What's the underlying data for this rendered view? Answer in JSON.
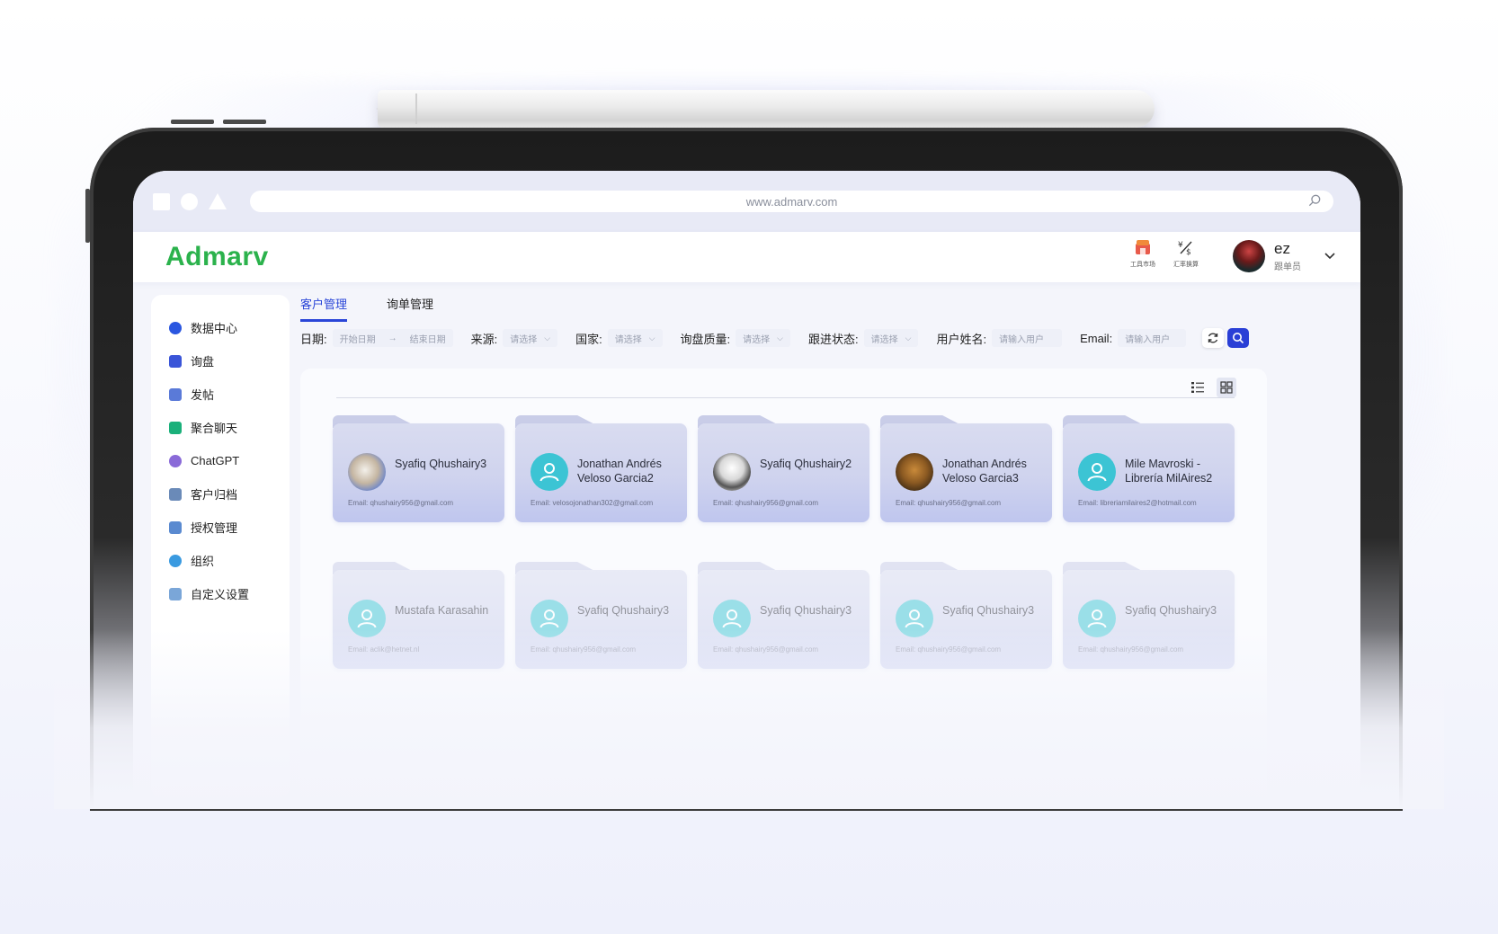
{
  "browser": {
    "url": "www.admarv.com"
  },
  "app": {
    "logo": {
      "part1": "Admar",
      "part2": "v"
    },
    "tools": [
      {
        "label": "工具市场",
        "icon": "market-icon"
      },
      {
        "label": "汇率换算",
        "icon": "currency-icon"
      }
    ],
    "user": {
      "name": "ez",
      "role": "跟单员"
    }
  },
  "sidebar": {
    "items": [
      {
        "label": "数据中心",
        "icon": "data-center-icon",
        "color": "#2a56e0"
      },
      {
        "label": "询盘",
        "icon": "inquiry-icon",
        "color": "#3a55d8"
      },
      {
        "label": "发帖",
        "icon": "post-icon",
        "color": "#5a7ad8"
      },
      {
        "label": "聚合聊天",
        "icon": "chat-icon",
        "color": "#1ab07a"
      },
      {
        "label": "ChatGPT",
        "icon": "chatgpt-icon",
        "color": "#8a6ad8"
      },
      {
        "label": "客户归档",
        "icon": "archive-icon",
        "color": "#6a8ab8"
      },
      {
        "label": "授权管理",
        "icon": "auth-icon",
        "color": "#5a8ad0"
      },
      {
        "label": "组织",
        "icon": "org-icon",
        "color": "#3a9ae0"
      },
      {
        "label": "自定义设置",
        "icon": "settings-icon",
        "color": "#7aa6d8"
      }
    ]
  },
  "tabs": [
    {
      "label": "客户管理",
      "active": true
    },
    {
      "label": "询单管理",
      "active": false
    }
  ],
  "filters": {
    "date_label": "日期:",
    "date_start": "开始日期",
    "date_arrow": "→",
    "date_end": "结束日期",
    "source_label": "来源:",
    "country_label": "国家:",
    "quality_label": "询盘质量:",
    "status_label": "跟进状态:",
    "select_placeholder": "请选择",
    "username_label": "用户姓名:",
    "username_placeholder": "请输入用户",
    "email_label": "Email:",
    "email_placeholder": "请输入用户"
  },
  "customers": [
    {
      "name": "Syafiq Qhushairy3",
      "email": "Email:  qhushairy956@gmail.com",
      "avatar": "photo1",
      "faded": false
    },
    {
      "name": "Jonathan Andrés Veloso Garcia2",
      "email": "Email:  velosojonathan302@gmail.com",
      "avatar": "default",
      "faded": false
    },
    {
      "name": "Syafiq Qhushairy2",
      "email": "Email:  qhushairy956@gmail.com",
      "avatar": "photo2",
      "faded": false
    },
    {
      "name": "Jonathan Andrés Veloso Garcia3",
      "email": "Email:  qhushairy956@gmail.com",
      "avatar": "photo3",
      "faded": false
    },
    {
      "name": "Mile Mavroski - Librería MilAires2",
      "email": "Email:  libreriamilaires2@hotmail.com",
      "avatar": "default",
      "faded": false
    },
    {
      "name": "Mustafa Karasahin",
      "email": "Email:  aclik@hetnet.nl",
      "avatar": "default",
      "faded": true
    },
    {
      "name": "Syafiq Qhushairy3",
      "email": "Email:  qhushairy956@gmail.com",
      "avatar": "default",
      "faded": true
    },
    {
      "name": "Syafiq Qhushairy3",
      "email": "Email:  qhushairy956@gmail.com",
      "avatar": "default",
      "faded": true
    },
    {
      "name": "Syafiq Qhushairy3",
      "email": "Email:  qhushairy956@gmail.com",
      "avatar": "default",
      "faded": true
    },
    {
      "name": "Syafiq Qhushairy3",
      "email": "Email:  qhushairy956@gmail.com",
      "avatar": "default",
      "faded": true
    }
  ],
  "colors": {
    "accent": "#2a46d8",
    "brand_green": "#2bb24c",
    "avatar_default": "#3cc4d4"
  }
}
